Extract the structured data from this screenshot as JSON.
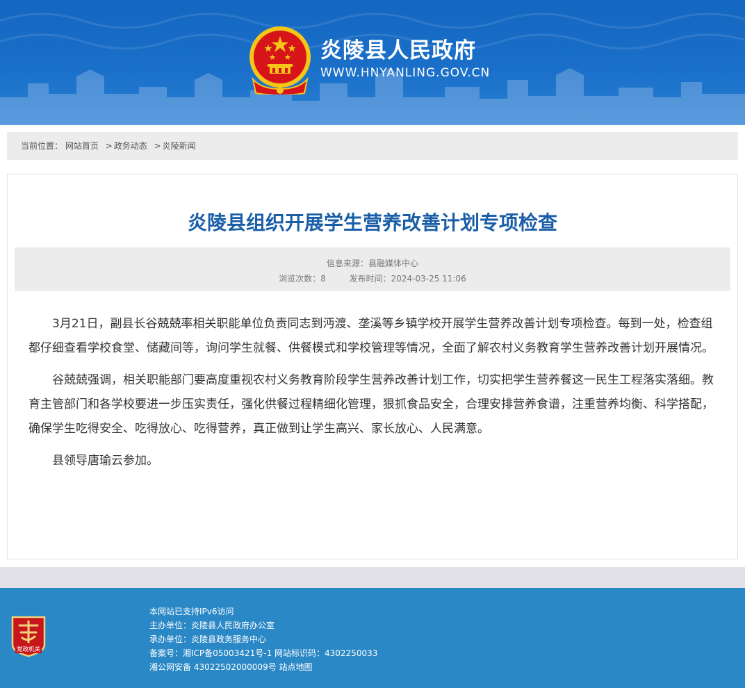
{
  "header": {
    "site_name": "炎陵县人民政府",
    "site_url": "WWW.HNYANLING.GOV.CN"
  },
  "breadcrumb": {
    "prefix": "当前位置：",
    "items": [
      "网站首页",
      "政务动态",
      "炎陵新闻"
    ],
    "separator": ">"
  },
  "article": {
    "title": "炎陵县组织开展学生营养改善计划专项检查",
    "meta": {
      "source_label": "信息来源：",
      "source": "县融媒体中心",
      "views_label": "浏览次数：",
      "views": "8",
      "date_label": "发布时间：",
      "date": "2024-03-25 11:06"
    },
    "paragraphs": [
      "3月21日，副县长谷兢兢率相关职能单位负责同志到沔渡、垄溪等乡镇学校开展学生营养改善计划专项检查。每到一处，检查组都仔细查看学校食堂、储藏间等，询问学生就餐、供餐模式和学校管理等情况，全面了解农村义务教育学生营养改善计划开展情况。",
      "谷兢兢强调，相关职能部门要高度重视农村义务教育阶段学生营养改善计划工作，切实把学生营养餐这一民生工程落实落细。教育主管部门和各学校要进一步压实责任，强化供餐过程精细化管理，狠抓食品安全，合理安排营养食谱，注重营养均衡、科学搭配，确保学生吃得安全、吃得放心、吃得营养，真正做到让学生高兴、家长放心、人民满意。",
      "县领导唐瑜云参加。"
    ]
  },
  "footer": {
    "badge_text": "党政机关",
    "lines": [
      "本网站已支持IPv6访问",
      "主办单位：炎陵县人民政府办公室",
      "承办单位：炎陵县政务服务中心",
      "备案号：湘ICP备05003421号-1 网站标识码：4302250033",
      "湘公网安备 43022502000009号 站点地图"
    ]
  },
  "colors": {
    "header_blue": "#1a6fc9",
    "title_blue": "#1a5ea8",
    "footer_blue": "#2b88c6",
    "emblem_red": "#d7141a",
    "emblem_gold": "#f5c518"
  }
}
